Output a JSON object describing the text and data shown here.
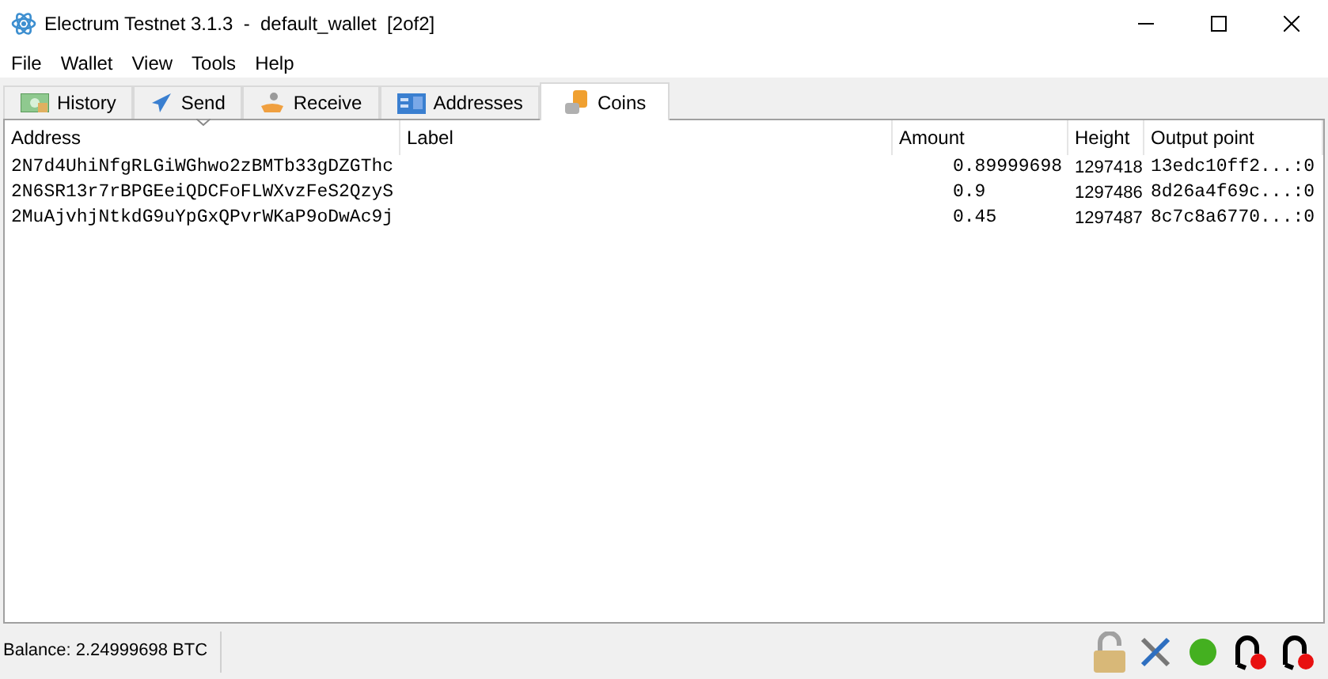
{
  "window": {
    "title": "Electrum Testnet 3.1.3  -  default_wallet  [2of2]"
  },
  "menu": [
    "File",
    "Wallet",
    "View",
    "Tools",
    "Help"
  ],
  "tabs": [
    {
      "label": "History",
      "selected": false,
      "kind": "history"
    },
    {
      "label": "Send",
      "selected": false,
      "kind": "send"
    },
    {
      "label": "Receive",
      "selected": false,
      "kind": "receive"
    },
    {
      "label": "Addresses",
      "selected": false,
      "kind": "addresses"
    },
    {
      "label": "Coins",
      "selected": true,
      "kind": "coins"
    }
  ],
  "table": {
    "columns": [
      "Address",
      "Label",
      "Amount",
      "Height",
      "Output point"
    ],
    "rows": [
      [
        "2N7d4UhiNfgRLGiWGhwo2zBMTb33gDZGThc",
        "",
        "0.89999698",
        "1297418",
        "13edc10ff2...:0"
      ],
      [
        "2N6SR13r7rBPGEeiQDCFoFLWXvzFeS2QzyS",
        "",
        "0.9",
        "1297486",
        "8d26a4f69c...:0"
      ],
      [
        "2MuAjvhjNtkdG9uYpGxQPvrWKaP9oDwAc9j",
        "",
        "0.45",
        "1297487",
        "8c7c8a6770...:0"
      ]
    ]
  },
  "status_bar": {
    "balance": "Balance: 2.24999698 BTC"
  }
}
